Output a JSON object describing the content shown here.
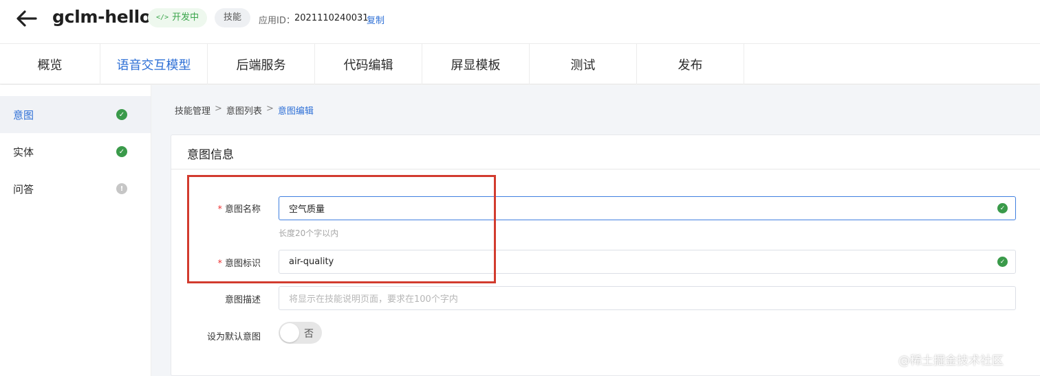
{
  "header": {
    "app_title": "gclm-hello",
    "status_badge": "开发中",
    "type_badge": "技能",
    "app_id_label": "应用ID：",
    "app_id_value": "2021110240031",
    "copy_label": "复制"
  },
  "tabs": [
    {
      "label": "概览",
      "active": false
    },
    {
      "label": "语音交互模型",
      "active": true
    },
    {
      "label": "后端服务",
      "active": false
    },
    {
      "label": "代码编辑",
      "active": false
    },
    {
      "label": "屏显模板",
      "active": false
    },
    {
      "label": "测试",
      "active": false
    },
    {
      "label": "发布",
      "active": false
    }
  ],
  "sidebar": {
    "items": [
      {
        "label": "意图",
        "status": "ok",
        "active": true
      },
      {
        "label": "实体",
        "status": "ok",
        "active": false
      },
      {
        "label": "问答",
        "status": "warning",
        "active": false
      }
    ]
  },
  "breadcrumb": {
    "items": [
      "技能管理",
      "意图列表",
      "意图编辑"
    ],
    "separator": ">"
  },
  "card": {
    "title": "意图信息",
    "fields": {
      "name": {
        "required_mark": "*",
        "label": "意图名称",
        "value": "空气质量",
        "hint": "长度20个字以内"
      },
      "identifier": {
        "required_mark": "*",
        "label": "意图标识",
        "value": "air-quality"
      },
      "description": {
        "label": "意图描述",
        "placeholder": "将显示在技能说明页面，要求在100个字内"
      },
      "default": {
        "label": "设为默认意图",
        "toggle_text": "否",
        "value": false
      }
    }
  },
  "icons": {
    "back": "arrow-left-icon",
    "code": "code-icon",
    "status_ok": "check-circle-icon",
    "status_warning": "exclamation-circle-icon"
  },
  "colors": {
    "accent": "#2d6fd6",
    "success": "#3a9a4a",
    "highlight": "#d23b2e"
  },
  "watermark": "@稀土掘金技术社区"
}
